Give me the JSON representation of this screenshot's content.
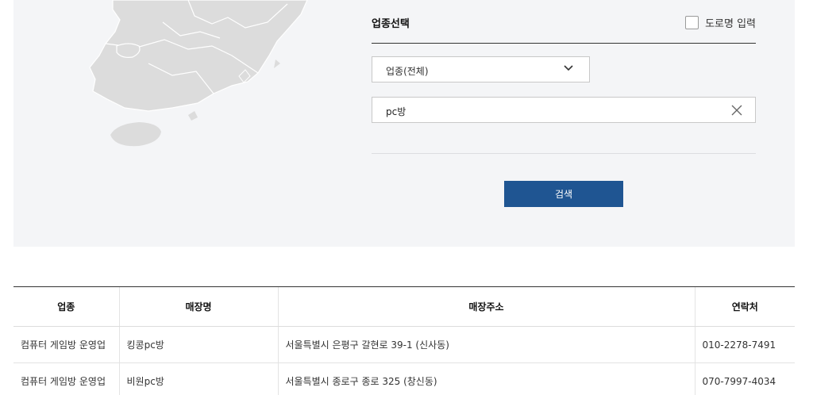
{
  "search_form": {
    "title": "업종선택",
    "road_name_label": "도로명 입력",
    "road_name_checked": false,
    "category_selected": "업종(전체)",
    "keyword_value": "pc방",
    "search_button": "검색"
  },
  "icons": {
    "dropdown": "chevron-down-icon",
    "clear": "close-icon"
  },
  "colors": {
    "panel_bg": "#f4f5f7",
    "map_fill": "#dcdcdc",
    "accent": "#1f5592"
  },
  "results": {
    "headers": [
      "업종",
      "매장명",
      "매장주소",
      "연락처"
    ],
    "rows": [
      [
        "컴퓨터 게임방 운영업",
        "킹콩pc방",
        "서울특별시 은평구 갈현로 39-1 (신사동)",
        "010-2278-7491"
      ],
      [
        "컴퓨터 게임방 운영업",
        "비원pc방",
        "서울특별시 종로구 종로 325 (창신동)",
        "070-7997-4034"
      ]
    ]
  }
}
